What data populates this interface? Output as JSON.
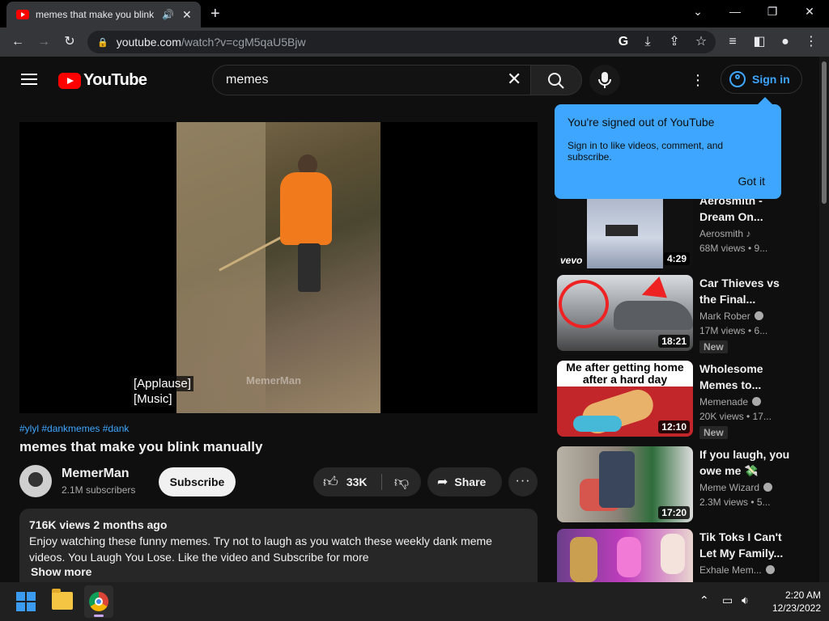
{
  "browser": {
    "tab_title": "memes that make you blink manually - YouTube",
    "url_host": "youtube.com",
    "url_path": "/watch?v=cgM5qaU5Bjw"
  },
  "youtube": {
    "logo_text": "YouTube",
    "search_query": "memes",
    "signin_label": "Sign in",
    "tooltip": {
      "title": "You're signed out of YouTube",
      "body": "Sign in to like videos, comment, and subscribe.",
      "button": "Got it"
    },
    "video": {
      "caption_line1": "[Applause]",
      "caption_line2": "[Music]",
      "watermark": "MemerMan",
      "hashtags": "#ylyl #dankmemes #dank",
      "title": "memes that make you blink manually",
      "channel_name": "MemerMan",
      "subscribers": "2.1M subscribers",
      "subscribe_label": "Subscribe",
      "like_count": "33K",
      "share_label": "Share",
      "views_date": "716K views  2 months ago",
      "description": "Enjoy watching these funny memes. Try not to laugh as you watch these weekly dank meme videos. You Laugh You Lose. Like the video and Subscribe for more",
      "show_more": "Show more"
    },
    "sidebar": [
      {
        "title": "Aerosmith - Dream On...",
        "channel": "Aerosmith",
        "views": "68M views • 9...",
        "duration": "4:29",
        "thumb_label": "vevo",
        "badge": ""
      },
      {
        "title": "Car Thieves vs the Final...",
        "channel": "Mark Rober",
        "views": "17M views • 6...",
        "duration": "18:21",
        "thumb_label": "",
        "badge": "New"
      },
      {
        "title": "Wholesome Memes to...",
        "channel": "Memenade",
        "views": "20K views • 17...",
        "duration": "12:10",
        "thumb_label": "Me after getting home after a hard day",
        "badge": "New"
      },
      {
        "title": "If you laugh, you owe me 💸",
        "channel": "Meme Wizard",
        "views": "2.3M views • 5...",
        "duration": "17:20",
        "thumb_label": "",
        "badge": ""
      },
      {
        "title": "Tik Toks I Can't Let My Family...",
        "channel": "Exhale Mem...",
        "views": "",
        "duration": "",
        "thumb_label": "",
        "badge": ""
      }
    ]
  },
  "taskbar": {
    "time": "2:20 AM",
    "date": "12/23/2022"
  },
  "colors": {
    "yt_bg": "#0f0f0f",
    "accent_blue": "#3ea6ff",
    "yt_red": "#ff0000"
  }
}
